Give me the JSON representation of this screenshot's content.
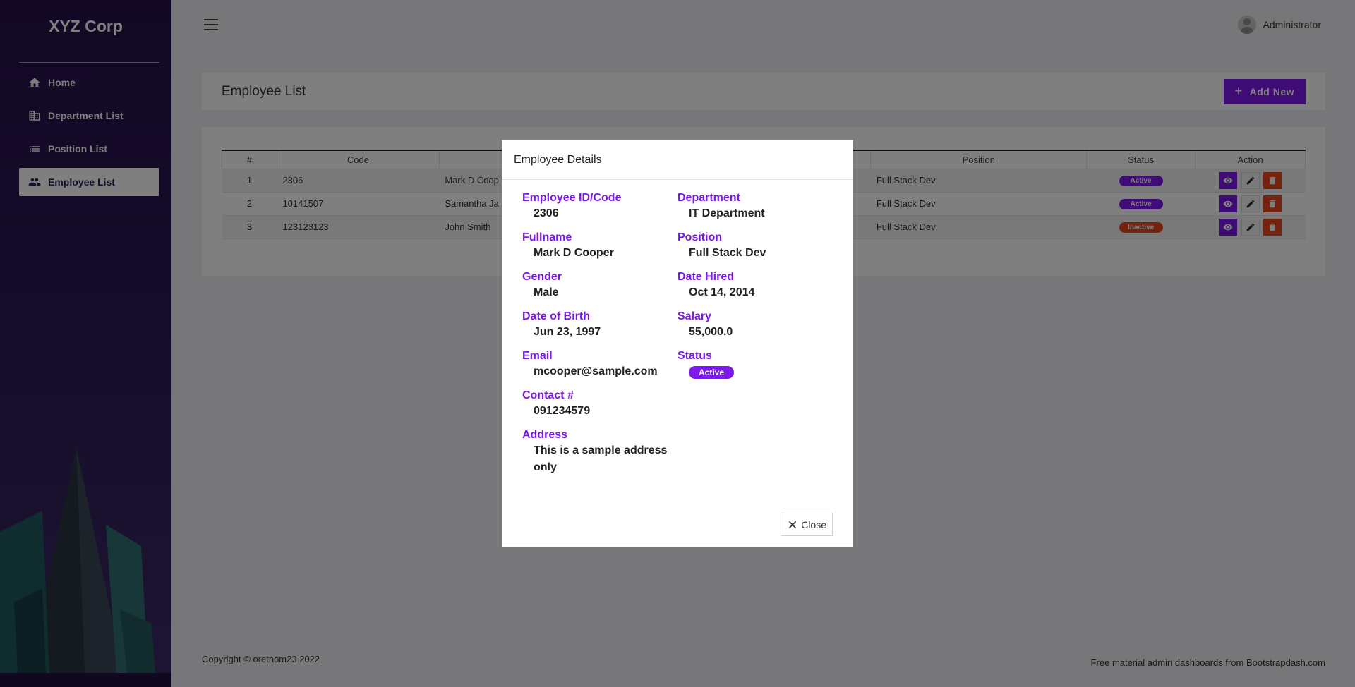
{
  "sidebar": {
    "brand": "XYZ Corp",
    "items": [
      {
        "label": "Home",
        "icon": "home-icon"
      },
      {
        "label": "Department List",
        "icon": "building-icon"
      },
      {
        "label": "Position List",
        "icon": "list-icon"
      },
      {
        "label": "Employee List",
        "icon": "people-icon",
        "active": true
      }
    ]
  },
  "topbar": {
    "user": "Administrator"
  },
  "page": {
    "title": "Employee List",
    "add_button": "Add New"
  },
  "table": {
    "columns": [
      "#",
      "Code",
      "",
      "",
      "Position",
      "Status",
      "Action"
    ],
    "rows": [
      {
        "num": "1",
        "code": "2306",
        "name": "Mark D Coop",
        "position": "Full Stack Dev",
        "status": "Active"
      },
      {
        "num": "2",
        "code": "10141507",
        "name": "Samantha Ja",
        "position": "Full Stack Dev",
        "status": "Active"
      },
      {
        "num": "3",
        "code": "123123123",
        "name": "John Smith",
        "position": "Full Stack Dev",
        "status": "Inactive"
      }
    ]
  },
  "footer": {
    "copyright": "Copyright © oretnom23 2022",
    "credit": "Free material admin dashboards from Bootstrapdash.com"
  },
  "modal": {
    "title": "Employee Details",
    "labels": {
      "code": "Employee ID/Code",
      "fullname": "Fullname",
      "gender": "Gender",
      "dob": "Date of Birth",
      "email": "Email",
      "contact": "Contact #",
      "address": "Address",
      "department": "Department",
      "position": "Position",
      "date_hired": "Date Hired",
      "salary": "Salary",
      "status": "Status"
    },
    "values": {
      "code": "2306",
      "fullname": "Mark D Cooper",
      "gender": "Male",
      "dob": "Jun 23, 1997",
      "email": "mcooper@sample.com",
      "contact": "091234579",
      "address": "This is a sample address only",
      "department": "IT Department",
      "position": "Full Stack Dev",
      "date_hired": "Oct 14, 2014",
      "salary": "55,000.0",
      "status": "Active"
    },
    "close_label": "Close"
  },
  "colors": {
    "accent": "#7c18e8",
    "danger": "#e8471e",
    "sidebar": "#241149"
  }
}
